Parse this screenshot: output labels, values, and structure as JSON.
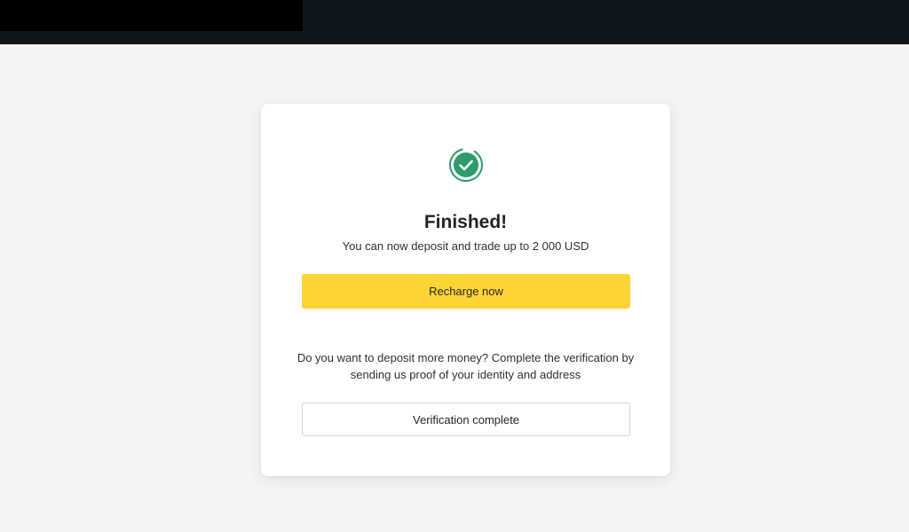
{
  "colors": {
    "topbar": "#0f171c",
    "page_background": "#f3f4f6",
    "accent_yellow": "#fcd535",
    "success_green": "#2d9b6a"
  },
  "status": {
    "icon": "check-circle-icon",
    "title": "Finished!",
    "subtitle": "You can now deposit and trade up to 2 000 USD"
  },
  "actions": {
    "recharge_label": "Recharge now",
    "verification_label": "Verification complete"
  },
  "info": {
    "text": "Do you want to deposit more money? Complete the verification by sending us proof of your identity and address"
  }
}
